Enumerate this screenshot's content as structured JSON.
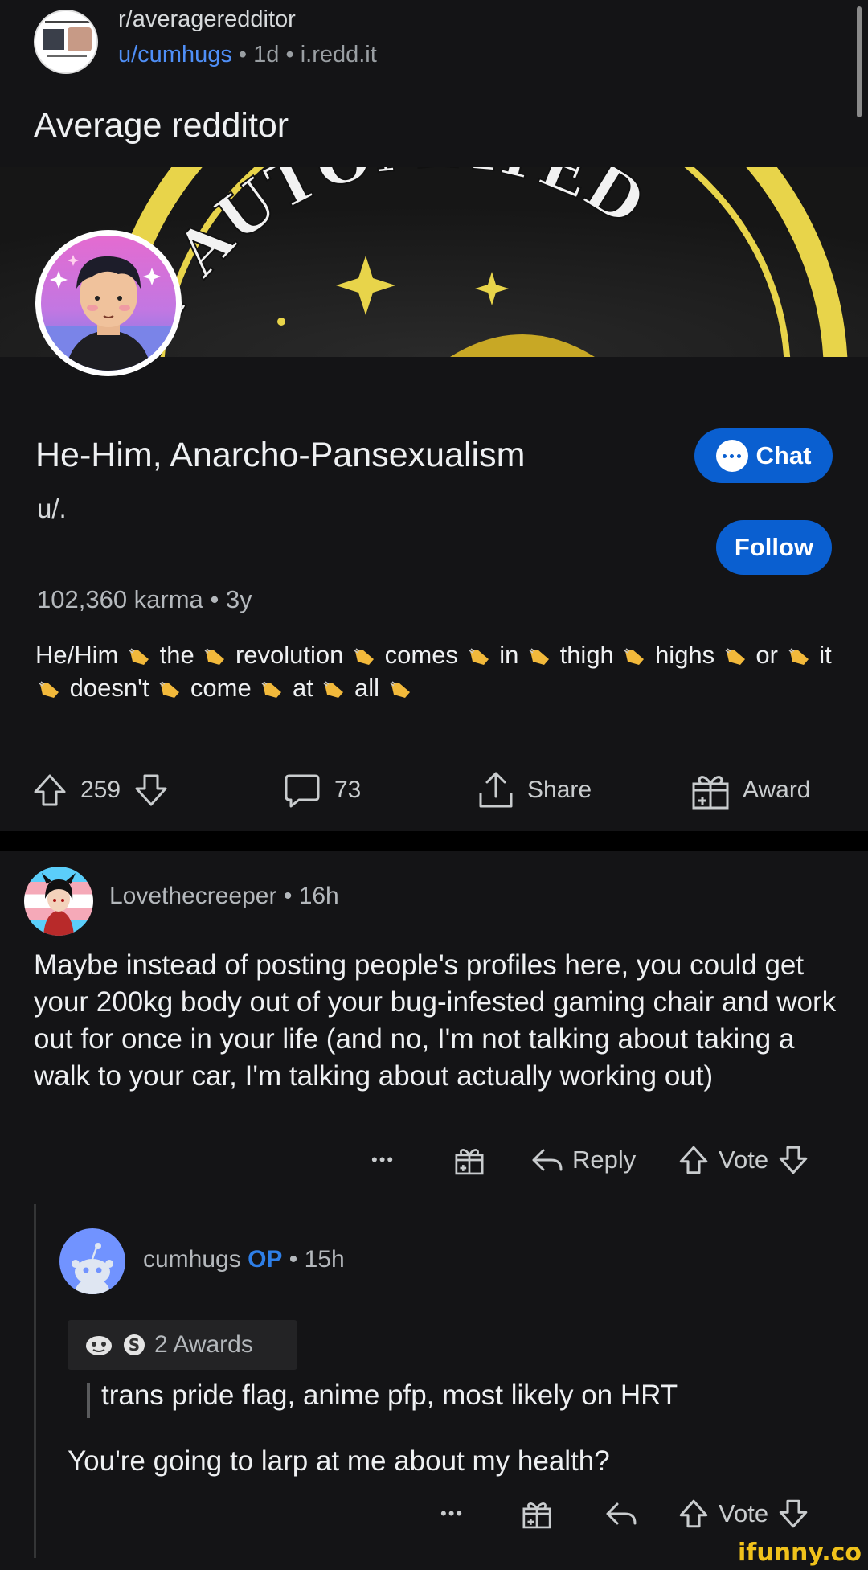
{
  "post": {
    "subreddit": "r/averageredditor",
    "author": "u/cumhugs",
    "age": "1d",
    "domain": "i.redd.it",
    "separator": "•",
    "title": "Average redditor"
  },
  "banner": {
    "text": "LLY AUTOMATED"
  },
  "profile": {
    "name": "He-Him, Anarcho-Pansexualism",
    "handle": "u/.",
    "chat_label": "Chat",
    "follow_label": "Follow",
    "karma": "102,360 karma",
    "age": "3y",
    "bio_words_line1": [
      "He/Him",
      "the",
      "revolution",
      "comes",
      "in",
      "thigh",
      "highs",
      "or",
      "it"
    ],
    "bio_words_line2": [
      "doesn't",
      "come",
      "at",
      "all"
    ]
  },
  "actions": {
    "upvotes": "259",
    "comments": "73",
    "share": "Share",
    "award": "Award"
  },
  "comment": {
    "author": "Lovethecreeper",
    "age": "16h",
    "body": "Maybe instead of posting people's profiles here, you could get your 200kg body out of your bug-infested gaming chair and work out for once in your life (and no, I'm not talking about taking a walk to your car, I'm talking about actually working out)",
    "more": "•••",
    "reply": "Reply",
    "vote": "Vote"
  },
  "reply": {
    "author": "cumhugs",
    "op_badge": "OP",
    "age": "15h",
    "awards": "2 Awards",
    "quote": "trans pride flag, anime pfp, most likely on HRT",
    "body": "You're going to larp at me about my health?",
    "more": "•••",
    "vote": "Vote"
  },
  "watermark": "ifunny.co",
  "colors": {
    "background": "#141416",
    "accent_blue": "#0a5fd0",
    "link_blue": "#4f8ff7",
    "op_blue": "#2e7fe8",
    "watermark_yellow": "#f0c21b"
  }
}
